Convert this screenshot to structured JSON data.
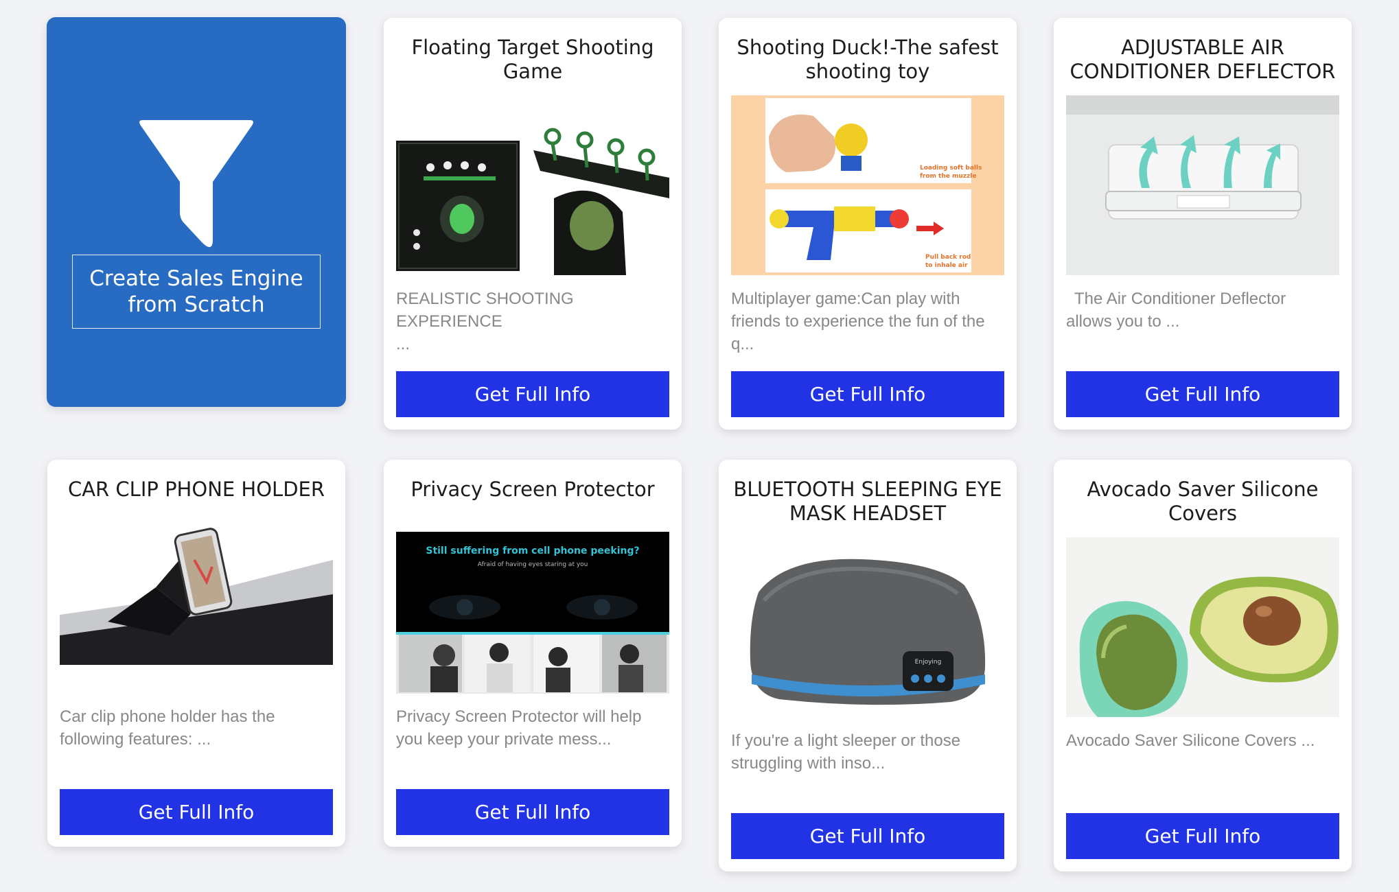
{
  "create_card": {
    "line1": "Create Sales Engine",
    "line2": "from Scratch"
  },
  "cta_label": "Get Full Info",
  "colors": {
    "page_background": "#f2f3f7",
    "create_card_background": "#276bc3",
    "cta_background": "#2233e6"
  },
  "products": [
    {
      "title_line1": "Floating Target Shooting",
      "title_line2": "Game",
      "desc_line1": "REALISTIC SHOOTING EXPERIENCE",
      "desc_line2": "..."
    },
    {
      "title_line1": "Shooting Duck!-The safest",
      "title_line2": "shooting toy",
      "desc_line1": "Multiplayer game:Can play with",
      "desc_line2": "friends to experience the fun of the",
      "desc_line3": "q...",
      "image_text": {
        "caption1_line1": "Loading soft balls",
        "caption1_line2": "from the muzzle",
        "caption2_line1": "Pull back rod",
        "caption2_line2": "to inhale air"
      }
    },
    {
      "title_line1": "ADJUSTABLE AIR",
      "title_line2": "CONDITIONER DEFLECTOR",
      "desc_line1": "The Air Conditioner Deflector",
      "desc_line2": "allows you to ..."
    },
    {
      "title_line1": "CAR CLIP PHONE HOLDER",
      "desc_line1": "Car clip phone holder has the",
      "desc_line2": "following features: ..."
    },
    {
      "title_line1": "Privacy Screen Protector",
      "desc_line1": "Privacy Screen Protector will help",
      "desc_line2": "you keep your private mess...",
      "image_text": {
        "headline": "Still suffering from cell phone peeking?",
        "subline": "Afraid of having eyes staring at you"
      }
    },
    {
      "title_line1": "BLUETOOTH SLEEPING EYE",
      "title_line2": "MASK HEADSET",
      "desc_line1": "If you're a light sleeper or those",
      "desc_line2": "struggling with inso...",
      "image_text": {
        "badge": "Enjoying"
      }
    },
    {
      "title_line1": "Avocado Saver Silicone",
      "title_line2": "Covers",
      "desc_line1": "Avocado Saver Silicone Covers ..."
    }
  ]
}
